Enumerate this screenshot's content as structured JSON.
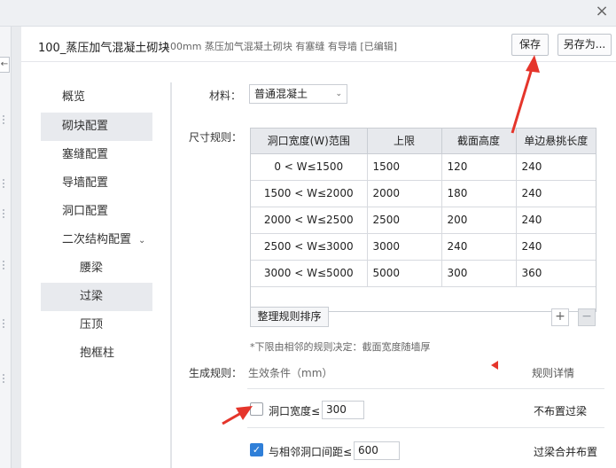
{
  "window": {
    "close_glyph": "×"
  },
  "left_strip": {
    "collapse_glyph": "←"
  },
  "header": {
    "title": "100_蒸压加气混凝土砌块",
    "subtitle": "100mm 蒸压加气混凝土砌块 有塞缝 有导墙 [已编辑]",
    "save_label": "保存",
    "save_as_label": "另存为..."
  },
  "nav": {
    "items": [
      {
        "label": "概览"
      },
      {
        "label": "砌块配置"
      },
      {
        "label": "塞缝配置"
      },
      {
        "label": "导墙配置"
      },
      {
        "label": "洞口配置"
      },
      {
        "label": "二次结构配置"
      },
      {
        "label": "腰梁"
      },
      {
        "label": "过梁"
      },
      {
        "label": "压顶"
      },
      {
        "label": "抱框柱"
      }
    ],
    "expand_glyph": "⌄"
  },
  "material": {
    "label": "材料：",
    "value": "普通混凝土"
  },
  "size_rules": {
    "label": "尺寸规则：",
    "columns": [
      "洞口宽度(W)范围",
      "上限",
      "截面高度",
      "单边悬挑长度"
    ],
    "rows": [
      [
        "0 < W≤1500",
        "1500",
        "120",
        "240"
      ],
      [
        "1500 < W≤2000",
        "2000",
        "180",
        "240"
      ],
      [
        "2000 < W≤2500",
        "2500",
        "200",
        "240"
      ],
      [
        "2500 < W≤3000",
        "3000",
        "240",
        "240"
      ],
      [
        "3000 < W≤5000",
        "5000",
        "300",
        "360"
      ]
    ],
    "sort_label": "整理规则排序",
    "add_glyph": "+",
    "remove_glyph": "−",
    "note": "*下限由相邻的规则决定：截面宽度随墙厚"
  },
  "generate_rules": {
    "label": "生成规则：",
    "condition_header": "生效条件（mm）",
    "detail_header": "规则详情",
    "rules": [
      {
        "checked": false,
        "label": "洞口宽度≤",
        "value": "300",
        "result": "不布置过梁"
      },
      {
        "checked": true,
        "label": "与相邻洞口间距≤",
        "value": "600",
        "result": "过梁合并布置"
      }
    ]
  },
  "colors": {
    "accent": "#2f7fd8",
    "annotation": "#e5352b"
  }
}
